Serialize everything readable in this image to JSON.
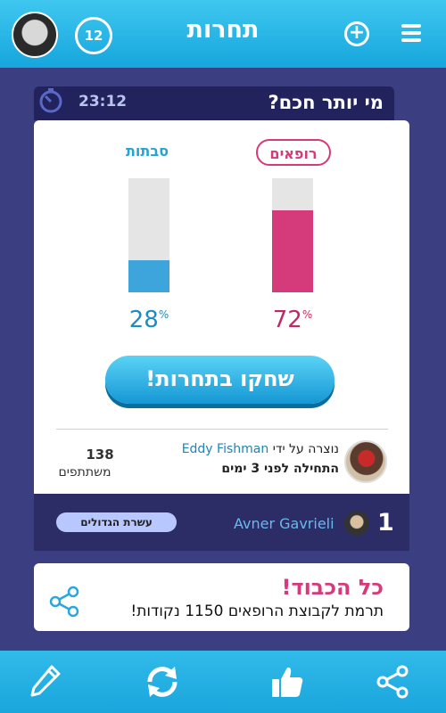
{
  "header": {
    "title": "תחרות",
    "level": "12"
  },
  "question": {
    "timer": "23:12",
    "text": "מי יותר חכם?"
  },
  "poll": {
    "right": {
      "label": "רופאים",
      "percent": "72",
      "color": "#d53a7a",
      "fraction": 0.72
    },
    "left": {
      "label": "סבתות",
      "percent": "28",
      "color": "#3ea4dc",
      "fraction": 0.28
    },
    "percent_symbol": "%",
    "cta_label": "שחקו בתחרות!"
  },
  "creator": {
    "prefix": "נוצרה על ידי",
    "name": "Eddy Fishman",
    "started": "התחילה לפני 3 ימים",
    "participants_count": "138",
    "participants_label": "משתתפים"
  },
  "leaderboard": {
    "rank": "1",
    "name": "Avner Gavrieli",
    "top10_label": "עשרת הגדולים"
  },
  "notification": {
    "title": "כל הכבוד!",
    "body": "תרמת לקבוצת הרופאים 1150 נקודות!"
  },
  "bottom_nav": [
    {
      "icon": "pencil-icon"
    },
    {
      "icon": "refresh-icon"
    },
    {
      "icon": "thumbs-up-icon"
    },
    {
      "icon": "share-icon"
    }
  ]
}
